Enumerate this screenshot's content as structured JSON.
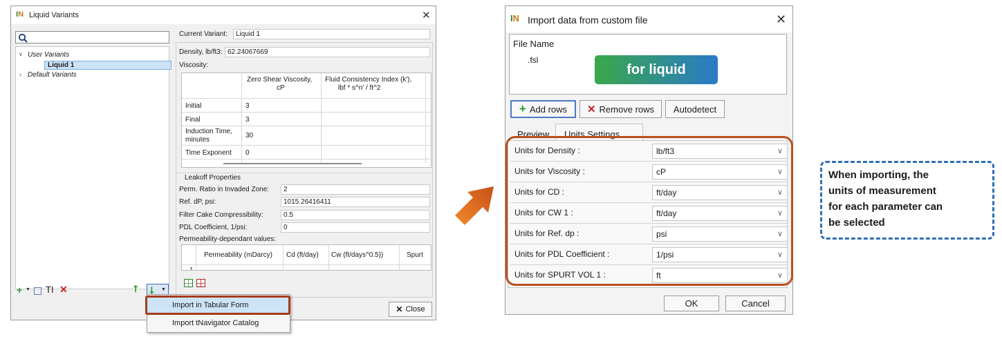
{
  "liquid_variants_window": {
    "title": "Liquid Variants",
    "search": {
      "placeholder": ""
    },
    "tree": {
      "user_variants": "User Variants",
      "selected_item": "Liquid 1",
      "default_variants": "Default Variants"
    },
    "current_variant_label": "Current Variant:",
    "current_variant_value": "Liquid 1",
    "density_label": "Density, lb/ft3:",
    "density_value": "62.24067669",
    "viscosity_label": "Viscosity:",
    "viscosity_table": {
      "col1": "Zero Shear Viscosity,",
      "col1b": "cP",
      "col2": "Fluid Consistency Index (k'),",
      "col2b": "lbf * s^n' / ft^2",
      "rows": [
        {
          "label": "Initial",
          "value": "3"
        },
        {
          "label": "Final",
          "value": "3"
        },
        {
          "label": "Induction Time,",
          "label2": "minutes",
          "value": "30"
        },
        {
          "label": "Time Exponent",
          "value": "0"
        }
      ]
    },
    "leakoff_title": "Leakoff Properties",
    "perm_ratio_label": "Perm. Ratio in Invaded Zone:",
    "perm_ratio_value": "2",
    "ref_dp_label": "Ref. dP, psi:",
    "ref_dp_value": "1015.26416411",
    "filter_cake_label": "Filter Cake Compressibility:",
    "filter_cake_value": "0.5",
    "pdl_label": "PDL Coefficient, 1/psi:",
    "pdl_value": "0",
    "perm_dep_label": "Permeability-dependant values:",
    "perm_table_headers": [
      "Permeability (mDarcy)",
      "Cd (ft/day)",
      "Cw (ft/days^0.5))",
      "Spurt"
    ],
    "perm_table_row_num": "1",
    "close_button": "Close",
    "menu": {
      "item1": "Import in Tabular Form",
      "item2": "Import tNavigator Catalog"
    }
  },
  "import_window": {
    "title": "Import data from custom file",
    "file_name_label": "File Name",
    "file_ext": ".fsl",
    "banner": "for liquid",
    "add_rows": "Add rows",
    "remove_rows": "Remove rows",
    "autodetect": "Autodetect",
    "tabs": [
      "Preview",
      "Units Settings"
    ],
    "units": [
      {
        "label": "Units for Density :",
        "value": "lb/ft3"
      },
      {
        "label": "Units for Viscosity :",
        "value": "cP"
      },
      {
        "label": "Units for CD :",
        "value": "ft/day"
      },
      {
        "label": "Units for CW 1 :",
        "value": "ft/day"
      },
      {
        "label": "Units for Ref. dp :",
        "value": "psi"
      },
      {
        "label": "Units for PDL Coefficient :",
        "value": "1/psi"
      },
      {
        "label": "Units for SPURT VOL 1 :",
        "value": "ft"
      }
    ],
    "ok": "OK",
    "cancel": "Cancel"
  },
  "callout": {
    "line1": "When importing, the",
    "line2": "units of measurement",
    "line3": "for each parameter can",
    "line4": "be selected"
  },
  "colors": {
    "highlight_orange": "#c0501a",
    "arrow_orange": "#e0701a",
    "banner_from": "#3aa84a",
    "banner_to": "#2a7ac8",
    "callout_border": "#2f6fb4"
  }
}
